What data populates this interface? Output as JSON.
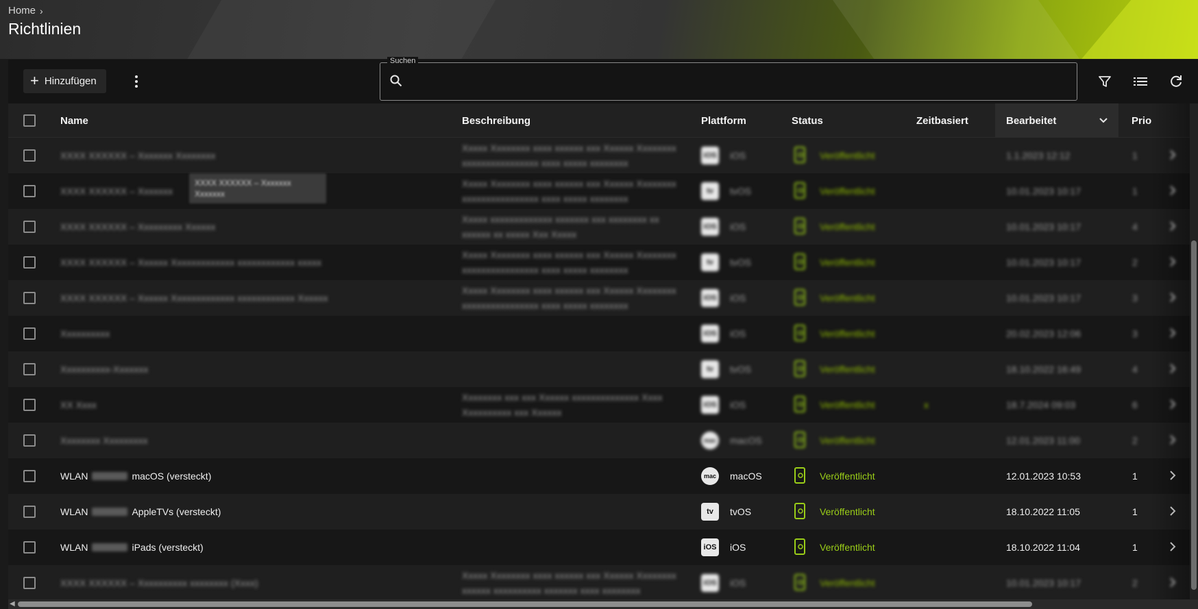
{
  "breadcrumb": {
    "home": "Home",
    "separator": "›"
  },
  "page": {
    "title": "Richtlinien"
  },
  "toolbar": {
    "add_label": "Hinzufügen",
    "search_label": "Suchen",
    "search_value": "",
    "icons": [
      "plus-icon",
      "more-vertical-icon",
      "search-icon",
      "filter-icon",
      "list-view-icon",
      "refresh-icon"
    ]
  },
  "table": {
    "columns": {
      "name": "Name",
      "description": "Beschreibung",
      "platform": "Plattform",
      "status": "Status",
      "timebased": "Zeitbasiert",
      "edited": "Bearbeitet",
      "priority": "Prio"
    },
    "sort": {
      "column": "Bearbeitet",
      "direction": "descending"
    },
    "rows": [
      {
        "name": "XXXX XXXXXX – Xxxxxxx Xxxxxxxx",
        "description": "Xxxxx Xxxxxxxx xxxx xxxxxx xxx Xxxxxx Xxxxxxxx xxxxxxxxxxxxxxxx xxxx xxxxx xxxxxxxx",
        "platform": "iOS",
        "platform_icon": "iOS",
        "status": "Veröffentlicht",
        "timebased": "",
        "edited": "1.1.2023 12:12",
        "priority": "1",
        "blurred": true
      },
      {
        "name": "XXXX XXXXXX – Xxxxxxx",
        "description": "Xxxxx Xxxxxxxx xxxx xxxxxx xxx Xxxxxx Xxxxxxxx xxxxxxxxxxxxxxxx xxxx xxxxx xxxxxxxx",
        "platform": "tvOS",
        "platform_icon": "tv",
        "status": "Veröffentlicht",
        "timebased": "",
        "edited": "10.01.2023 10:17",
        "priority": "1",
        "blurred": true
      },
      {
        "name": "XXXX XXXXXX – Xxxxxxxxx Xxxxxx",
        "description": "Xxxxx xxxxxxxxxxxxx xxxxxxx xxx xxxxxxxx xx xxxxxx xx xxxxx Xxx Xxxxx",
        "platform": "iOS",
        "platform_icon": "iOS",
        "status": "Veröffentlicht",
        "timebased": "",
        "edited": "10.01.2023 10:17",
        "priority": "4",
        "blurred": true
      },
      {
        "name": "XXXX XXXXXX – Xxxxxx Xxxxxxxxxxxxx xxxxxxxxxxxx xxxxx",
        "description": "Xxxxx Xxxxxxxx xxxx xxxxxx xxx Xxxxxx Xxxxxxxx xxxxxxxxxxxxxxxx xxxx xxxxx xxxxxxxx",
        "platform": "tvOS",
        "platform_icon": "tv",
        "status": "Veröffentlicht",
        "timebased": "",
        "edited": "10.01.2023 10:17",
        "priority": "2",
        "blurred": true
      },
      {
        "name": "XXXX XXXXXX – Xxxxxx Xxxxxxxxxxxxx xxxxxxxxxxxx Xxxxxx",
        "description": "Xxxxx Xxxxxxxx xxxx xxxxxx xxx Xxxxxx Xxxxxxxx xxxxxxxxxxxxxxxx xxxx xxxxx xxxxxxxx",
        "platform": "iOS",
        "platform_icon": "iOS",
        "status": "Veröffentlicht",
        "timebased": "",
        "edited": "10.01.2023 10:17",
        "priority": "3",
        "blurred": true
      },
      {
        "name": "Xxxxxxxxxx",
        "description": "",
        "platform": "iOS",
        "platform_icon": "iOS",
        "status": "Veröffentlicht",
        "timebased": "",
        "edited": "20.02.2023 12:06",
        "priority": "3",
        "blurred": true
      },
      {
        "name": "Xxxxxxxxxx-Xxxxxxx",
        "description": "",
        "platform": "tvOS",
        "platform_icon": "tv",
        "status": "Veröffentlicht",
        "timebased": "",
        "edited": "18.10.2022 16:49",
        "priority": "4",
        "blurred": true
      },
      {
        "name": "XX Xxxx",
        "description": "Xxxxxxxx xxx xxx Xxxxxx xxxxxxxxxxxxxx Xxxx Xxxxxxxxxx xxx Xxxxxx",
        "platform": "iOS",
        "platform_icon": "iOS",
        "status": "Veröffentlicht",
        "timebased": "x",
        "edited": "18.7.2024 09:03",
        "priority": "6",
        "blurred": true
      },
      {
        "name": "Xxxxxxxx Xxxxxxxxx",
        "description": "",
        "platform": "macOS",
        "platform_icon": "mac",
        "status": "Veröffentlicht",
        "timebased": "",
        "edited": "12.01.2023 11:00",
        "priority": "2",
        "blurred": true
      },
      {
        "name": "WLAN macOS (versteckt)",
        "name_prefix": "WLAN",
        "name_suffix": "macOS (versteckt)",
        "description": "",
        "platform": "macOS",
        "platform_icon": "mac",
        "status": "Veröffentlicht",
        "timebased": "",
        "edited": "12.01.2023 10:53",
        "priority": "1",
        "blurred": false
      },
      {
        "name": "WLAN AppleTVs (versteckt)",
        "name_prefix": "WLAN",
        "name_suffix": "AppleTVs (versteckt)",
        "description": "",
        "platform": "tvOS",
        "platform_icon": "tv",
        "status": "Veröffentlicht",
        "timebased": "",
        "edited": "18.10.2022 11:05",
        "priority": "1",
        "blurred": false
      },
      {
        "name": "WLAN iPads (versteckt)",
        "name_prefix": "WLAN",
        "name_suffix": "iPads (versteckt)",
        "description": "",
        "platform": "iOS",
        "platform_icon": "iOS",
        "status": "Veröffentlicht",
        "timebased": "",
        "edited": "18.10.2022 11:04",
        "priority": "1",
        "blurred": false
      },
      {
        "name": "XXXX XXXXXX – Xxxxxxxxxx xxxxxxxx (Xxxx)",
        "description": "Xxxxx Xxxxxxxx xxxx xxxxxx xxx Xxxxxx Xxxxxxxx xxxxxx xxxxxxxxxx xxxxxxx xxxx xxxxxxxx",
        "platform": "iOS",
        "platform_icon": "iOS",
        "status": "Veröffentlicht",
        "timebased": "",
        "edited": "10.01.2023 10:17",
        "priority": "2",
        "blurred": true
      }
    ]
  },
  "tooltip": {
    "text": "XXXX XXXXXX – Xxxxxxx Xxxxxxx"
  },
  "colors": {
    "accent": "#9acd18",
    "background": "#1a1a1a",
    "header_bg": "#212121"
  }
}
